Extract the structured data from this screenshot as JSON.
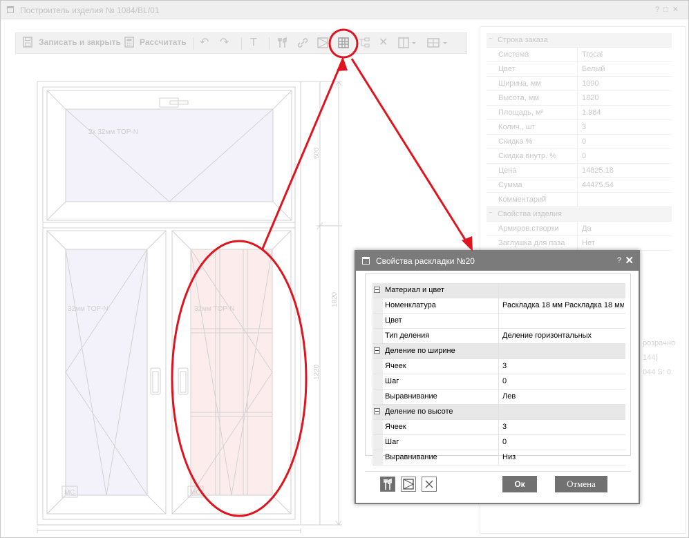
{
  "window": {
    "title": "Построитель изделия № 1084/BL/01",
    "controls": [
      "?",
      "□",
      "✕"
    ]
  },
  "toolbar": {
    "save_close_label": "Записать и закрыть",
    "calculate_label": "Рассчитать"
  },
  "drawing": {
    "top_glass_label": "2x 32мм TOP-N",
    "left_glass_label": "32мм TOP-N",
    "right_glass_label": "32мм TOP-N",
    "dim_top": "600",
    "dim_total": "1820",
    "dim_bottom": "1220",
    "mc_label_left": "МС",
    "mc_label_right": "МС"
  },
  "order_panel": {
    "group_label": "Строка заказа",
    "rows": [
      {
        "label": "Система",
        "value": "Trocal"
      },
      {
        "label": "Цвет",
        "value": "Белый"
      },
      {
        "label": "Ширина, мм",
        "value": "1090"
      },
      {
        "label": "Высота, мм",
        "value": "1820"
      },
      {
        "label": "Площадь, м²",
        "value": "1.984"
      },
      {
        "label": "Колич., шт",
        "value": "3"
      },
      {
        "label": "Скидка %",
        "value": "0"
      },
      {
        "label": "Скидка внутр. %",
        "value": "0"
      },
      {
        "label": "Цена",
        "value": "14825.18"
      },
      {
        "label": "Сумма",
        "value": "44475.54"
      },
      {
        "label": "Комментарий",
        "value": ""
      }
    ],
    "product_group_label": "Свойства изделия",
    "product_rows": [
      {
        "label": "Армиров.створки",
        "value": "Да"
      },
      {
        "label": "Заглушка для паза",
        "value": "Нет"
      }
    ],
    "partial_texts": [
      "розрачно",
      "144)",
      "044  S: 0."
    ]
  },
  "dialog": {
    "title": "Свойства раскладки №20",
    "help": "?",
    "close": "✕",
    "groups": [
      {
        "label": "Материал и цвет",
        "rows": [
          {
            "label": "Номенклатура",
            "value": "Раскладка 18 мм Раскладка 18 мм"
          },
          {
            "label": "Цвет",
            "value": ""
          },
          {
            "label": "Тип деления",
            "value": "Деление горизонтальных"
          }
        ]
      },
      {
        "label": "Деление по ширине",
        "rows": [
          {
            "label": "Ячеек",
            "value": "3"
          },
          {
            "label": "Шаг",
            "value": "0"
          },
          {
            "label": "Выравнивание",
            "value": "Лев"
          }
        ]
      },
      {
        "label": "Деление по высоте",
        "rows": [
          {
            "label": "Ячеек",
            "value": "3"
          },
          {
            "label": "Шаг",
            "value": "0"
          },
          {
            "label": "Выравнивание",
            "value": "Низ"
          }
        ]
      }
    ],
    "ok_label": "Ок",
    "cancel_label": "Отмена"
  },
  "colors": {
    "annotation": "#e0141e",
    "dialog_header": "#7b7b7b",
    "pane_pink": "#fcecec",
    "pane_lilac": "#f3f2fb"
  }
}
